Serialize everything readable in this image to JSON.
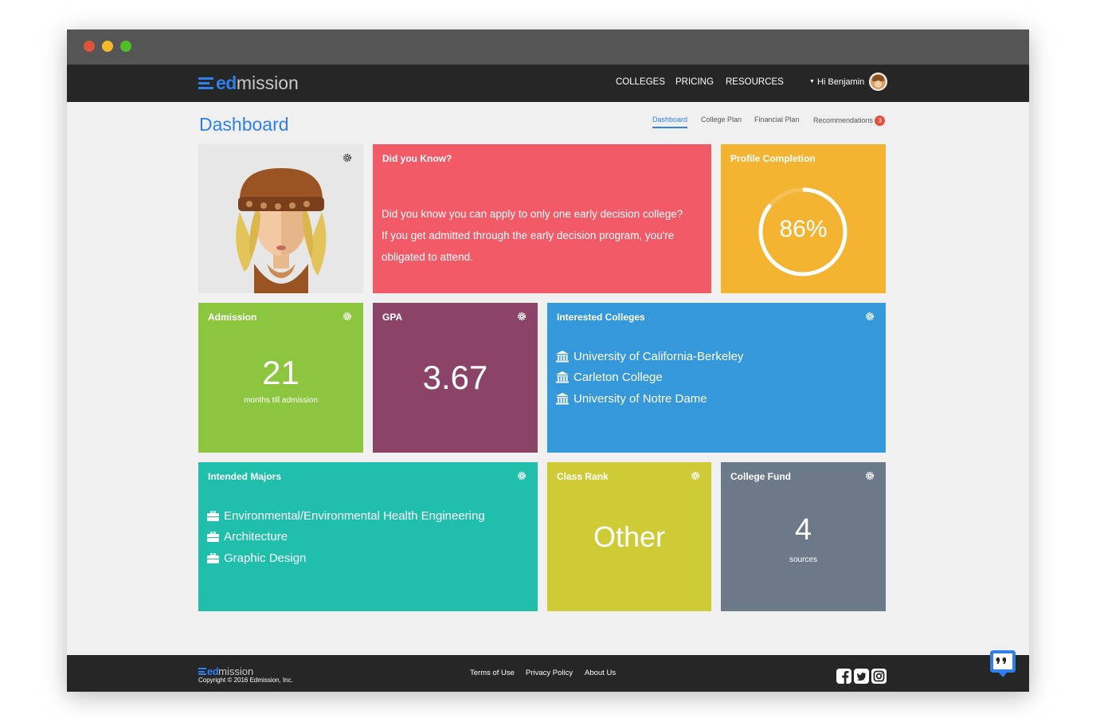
{
  "window": {
    "controls": [
      "close",
      "minimize",
      "maximize"
    ]
  },
  "nav": {
    "logo_ed": "ed",
    "logo_mission": "mission",
    "links": [
      "COLLEGES",
      "PRICING",
      "RESOURCES"
    ],
    "user_greeting": "Hi Benjamin",
    "avatar_icon": "user-avatar-icon"
  },
  "page": {
    "title": "Dashboard",
    "tabs": [
      "Dashboard",
      "College Plan",
      "Financial Plan",
      "Recommendations"
    ],
    "active_tab": "Dashboard",
    "recommendations_badge": "3"
  },
  "tiles": {
    "profile_photo": {
      "settings_icon": "gear-icon"
    },
    "did_you_know": {
      "title": "Did you Know?",
      "line1": "Did you know you can apply to only one early decision college?",
      "line2": "If you get admitted through the early decision program, you're",
      "line3": "obligated to attend.",
      "color": "#f15a66"
    },
    "profile_completion": {
      "title": "Profile Completion",
      "percent_label": "86%",
      "percent": 86,
      "color": "#f3b432"
    },
    "admission": {
      "title": "Admission",
      "value": "21",
      "label": "months till admission",
      "color": "#8cc63f"
    },
    "gpa": {
      "title": "GPA",
      "value": "3.67",
      "color": "#8b4468"
    },
    "interested_colleges": {
      "title": "Interested Colleges",
      "items": [
        "University of California-Berkeley",
        "Carleton College",
        "University of Notre Dame"
      ],
      "item_icon": "university-icon",
      "color": "#3498db"
    },
    "intended_majors": {
      "title": "Intended Majors",
      "items": [
        "Environmental/Environmental Health Engineering",
        "Architecture",
        "Graphic Design"
      ],
      "item_icon": "briefcase-icon",
      "color": "#1fbfab"
    },
    "class_rank": {
      "title": "Class Rank",
      "value": "Other",
      "color": "#cfcb37"
    },
    "college_fund": {
      "title": "College Fund",
      "value": "4",
      "label": "sources",
      "color": "#6c7989"
    }
  },
  "footer": {
    "logo_ed": "ed",
    "logo_mission": "mission",
    "copyright": "Copyright © 2016 Edmission, Inc.",
    "links": [
      "Terms of Use",
      "Privacy Policy",
      "About Us"
    ],
    "social_icons": [
      "facebook-icon",
      "twitter-icon",
      "instagram-icon"
    ]
  },
  "chat": {
    "icon": "chat-quote-icon",
    "color": "#2f80ed"
  }
}
